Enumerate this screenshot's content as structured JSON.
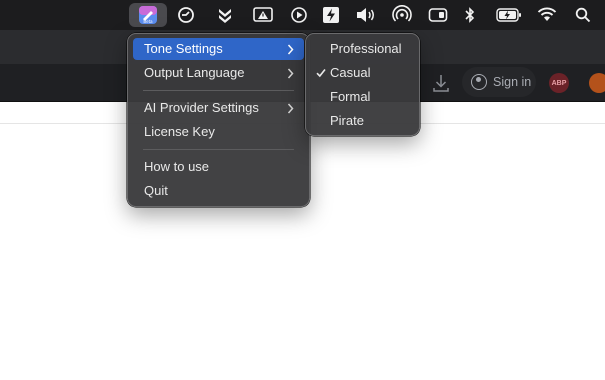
{
  "menu_bar": {
    "icons": [
      "app-active-icon",
      "clock-arrow-icon",
      "chevrons-down-icon",
      "display-warning-icon",
      "play-circle-icon",
      "lightning-icon",
      "volume-icon",
      "airdrop-icon",
      "input-icon",
      "bluetooth-icon",
      "battery-icon",
      "wifi-icon",
      "search-icon"
    ]
  },
  "browser": {
    "signin_label": "Sign in",
    "abp_label": "ABP"
  },
  "main_menu": {
    "items": [
      {
        "label": "Tone Settings",
        "has_submenu": true,
        "highlighted": true
      },
      {
        "label": "Output Language",
        "has_submenu": true
      },
      {
        "label": "AI Provider Settings",
        "has_submenu": true
      },
      {
        "label": "License Key"
      },
      {
        "label": "How to use"
      },
      {
        "label": "Quit"
      }
    ]
  },
  "tone_submenu": {
    "items": [
      {
        "label": "Professional",
        "checked": false
      },
      {
        "label": "Casual",
        "checked": true
      },
      {
        "label": "Formal",
        "checked": false
      },
      {
        "label": "Pirate",
        "checked": false
      }
    ]
  },
  "colors": {
    "menu_bg": "#3a3a3c",
    "highlight": "#2f66c8",
    "menubar_bg": "#1c1c1e"
  }
}
